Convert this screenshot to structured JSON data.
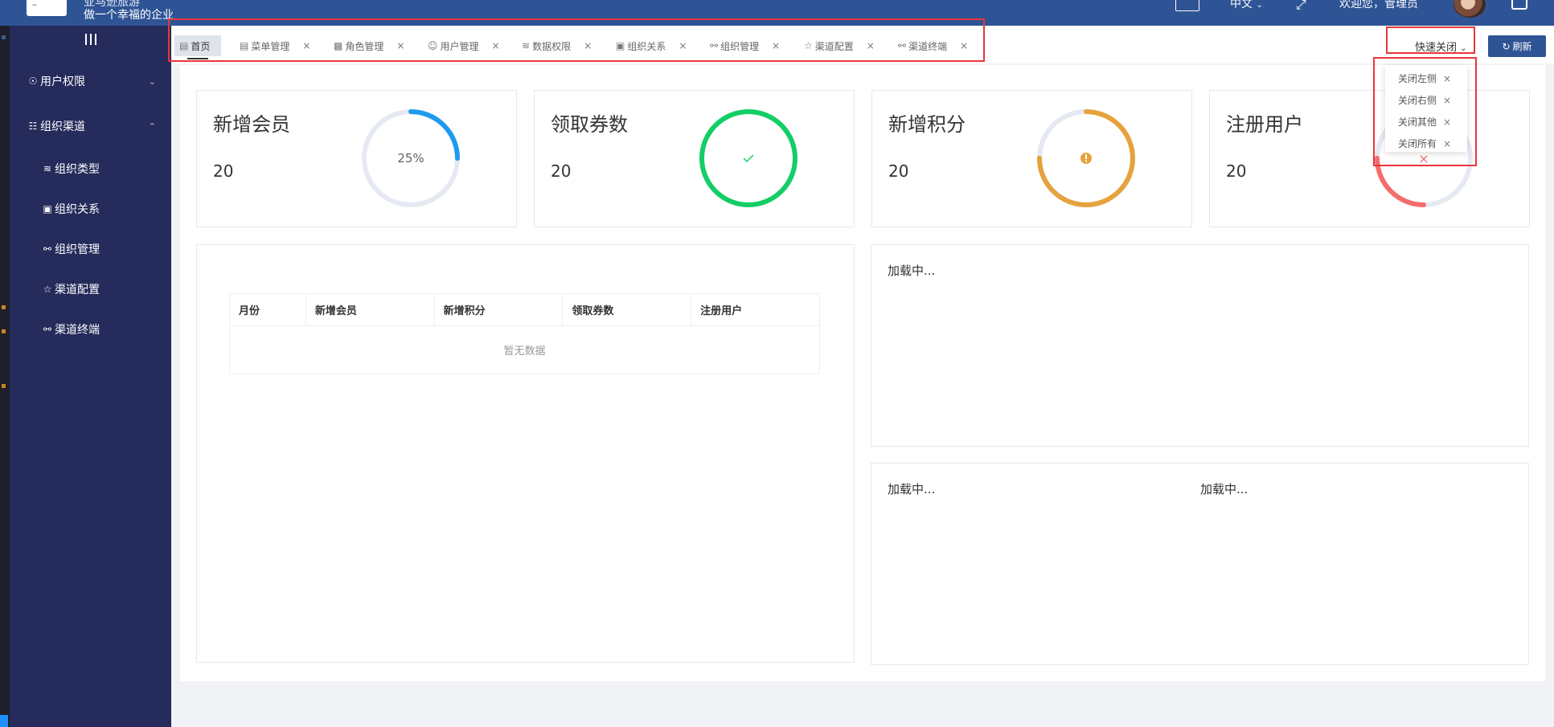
{
  "header": {
    "logo_text": "~",
    "slogan_top": "亚马逊旅游",
    "slogan": "做一个幸福的企业",
    "language": "中文",
    "welcome": "欢迎您，管理员",
    "language_chevron_icon": "chevron-down-icon",
    "fullscreen_icon": "fullscreen-icon",
    "logout_icon": "logout-icon"
  },
  "sidebar": {
    "toggle_icon": "hamburger-icon",
    "groups": [
      {
        "label": "用户权限",
        "icon": "user-icon",
        "expanded": false
      },
      {
        "label": "组织渠道",
        "icon": "org-icon",
        "expanded": true
      }
    ],
    "items": [
      {
        "label": "组织类型",
        "icon": "layers-icon"
      },
      {
        "label": "组织关系",
        "icon": "relation-icon"
      },
      {
        "label": "组织管理",
        "icon": "tree-icon"
      },
      {
        "label": "渠道配置",
        "icon": "star-icon"
      },
      {
        "label": "渠道终端",
        "icon": "tree-icon"
      }
    ]
  },
  "tabs": [
    {
      "label": "首页",
      "icon": "home-icon",
      "active": true
    },
    {
      "label": "菜单管理",
      "icon": "menu-doc-icon"
    },
    {
      "label": "角色管理",
      "icon": "role-icon"
    },
    {
      "label": "用户管理",
      "icon": "user-icon"
    },
    {
      "label": "数据权限",
      "icon": "layers-icon"
    },
    {
      "label": "组织关系",
      "icon": "relation-icon"
    },
    {
      "label": "组织管理",
      "icon": "tree-icon"
    },
    {
      "label": "渠道配置",
      "icon": "star-icon"
    },
    {
      "label": "渠道终端",
      "icon": "tree-icon"
    }
  ],
  "tab_close_symbol": "×",
  "toolbar": {
    "quick_close": "快速关闭",
    "refresh": "刷新"
  },
  "quick_close_menu": [
    {
      "label": "关闭左侧"
    },
    {
      "label": "关闭右侧"
    },
    {
      "label": "关闭其他"
    },
    {
      "label": "关闭所有"
    }
  ],
  "stats": [
    {
      "title": "新增会员",
      "value": "20",
      "ring_text": "25%",
      "progress": 0.25,
      "color": "#1e9bef",
      "status": "normal"
    },
    {
      "title": "领取券数",
      "value": "20",
      "progress": 1.0,
      "color": "#13ce66",
      "status": "success",
      "status_icon": "check-icon"
    },
    {
      "title": "新增积分",
      "value": "20",
      "progress": 0.75,
      "color": "#e6a23c",
      "status": "warning",
      "status_icon": "warning-icon"
    },
    {
      "title": "注册用户",
      "value": "20",
      "progress": 0.25,
      "color": "#f56c6c",
      "status": "exception",
      "status_icon": "close-icon"
    }
  ],
  "table": {
    "columns": [
      "月份",
      "新增会员",
      "新增积分",
      "领取券数",
      "注册用户"
    ],
    "empty_text": "暂无数据"
  },
  "loading": {
    "chart_right_top": "加载中...",
    "chart_bottom_left": "加载中...",
    "chart_bottom_right": "加载中..."
  }
}
